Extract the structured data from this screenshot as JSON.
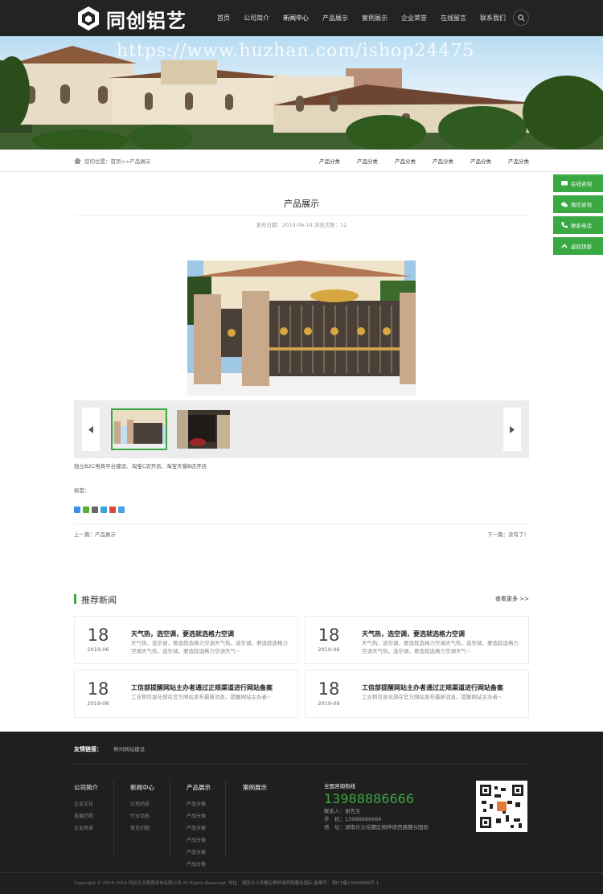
{
  "header": {
    "logo_text": "同创铝艺",
    "nav": [
      "首页",
      "公司简介",
      "新闻中心",
      "产品展示",
      "案例展示",
      "企业荣誉",
      "在线留言",
      "联系我们"
    ],
    "active_nav_index": 2
  },
  "banner": {
    "watermark": "https://www.huzhan.com/ishop24475"
  },
  "breadcrumb": {
    "text": "您的位置：首页>>产品展示"
  },
  "sub_categories": [
    "产品分类",
    "产品分类",
    "产品分类",
    "产品分类",
    "产品分类",
    "产品分类"
  ],
  "side_float": [
    "在线咨询",
    "微信咨询",
    "联系电话",
    "返回顶部"
  ],
  "article": {
    "title": "产品展示",
    "meta": "发布日期：2019-06-18   浏览次数：12",
    "description": "独立B2C电商平台建设、淘宝C店开店、淘宝天猫B店开店",
    "tags_label": "标签：",
    "prev": "上一篇：产品展示",
    "next": "下一篇：没有了！"
  },
  "news": {
    "title": "推荐新闻",
    "more": "查看更多 >>",
    "items": [
      {
        "day": "18",
        "ym": "2019-06",
        "title": "天气热，选空调，要选就选格力空调",
        "text": "天气热，选空调，要选就选格力空调天气热，选空调，要选就选格力空调天气热，选空调，要选就选格力空调天气~"
      },
      {
        "day": "18",
        "ym": "2019-06",
        "title": "天气热，选空调，要选就选格力空调",
        "text": "天气热，选空调，要选就选格力空调天气热，选空调，要选就选格力空调天气热，选空调，要选就选格力空调天气~"
      },
      {
        "day": "18",
        "ym": "2019-06",
        "title": "工信部提醒网站主办者通过正规渠道进行网站备案",
        "text": "工业和信息化部在官方网站发布最新消息，提醒网站主办者~"
      },
      {
        "day": "18",
        "ym": "2019-06",
        "title": "工信部提醒网站主办者通过正规渠道进行网站备案",
        "text": "工业和信息化部在官方网站发布最新消息，提醒网站主办者~"
      }
    ]
  },
  "footer": {
    "links_label": "友情链接：",
    "links": [
      "柳州网站建设"
    ],
    "columns": [
      {
        "title": "公司简介",
        "items": [
          "企业文化",
          "发展历程",
          "企业风采"
        ]
      },
      {
        "title": "新闻中心",
        "items": [
          "公司动态",
          "行业动态",
          "常见问题"
        ]
      },
      {
        "title": "产品展示",
        "items": [
          "产品分类",
          "产品分类",
          "产品分类",
          "产品分类",
          "产品分类",
          "产品分类"
        ]
      },
      {
        "title": "案例展示",
        "items": []
      }
    ],
    "hotline_label": "全国咨询热线",
    "hotline": "13988886666",
    "contact_person": "联系人：谢先生",
    "phone": "手　机：13988886666",
    "address": "地　址：湖南长沙岳麓区桐梓坡西路麓谷国际",
    "copyright": "Copyright © 2018-2019 同创企业管理咨询有限公司 All Rights Reserved.   地址：湖南长沙岳麓区桐梓坡西路麓谷国际   备案号：湘ICP备13006888号-1"
  },
  "colors": {
    "accent": "#3aa843",
    "header_bg": "#232323",
    "footer_bg": "#1f1f1f"
  }
}
